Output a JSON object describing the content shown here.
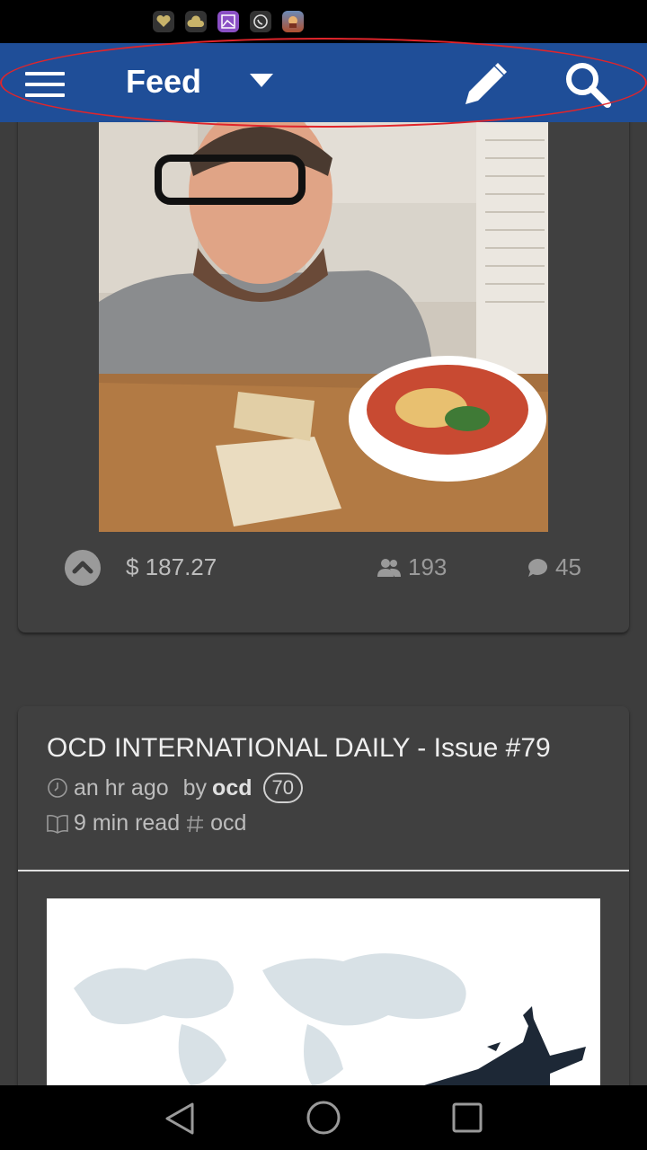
{
  "status_bar": {
    "icons": [
      "health-app-icon",
      "weather-app-icon",
      "gallery-app-icon",
      "whatsapp-icon",
      "game-app-icon"
    ]
  },
  "app_bar": {
    "title": "Feed",
    "background": "#1f4e98",
    "icons": [
      "menu-icon",
      "dropdown-arrow-icon",
      "pencil-icon",
      "search-icon"
    ]
  },
  "post1": {
    "image_description_icon": "photo",
    "payout": "$ 187.27",
    "voters": "193",
    "comments": "45"
  },
  "post2": {
    "title": "OCD INTERNATIONAL DAILY - Issue #79",
    "time": "an hr ago",
    "by_label": "by",
    "author": "ocd",
    "reputation": "70",
    "read_time": "9 min read",
    "tag": "ocd"
  },
  "nav_bar": {
    "icons": [
      "back-icon",
      "home-icon",
      "recents-icon"
    ]
  }
}
